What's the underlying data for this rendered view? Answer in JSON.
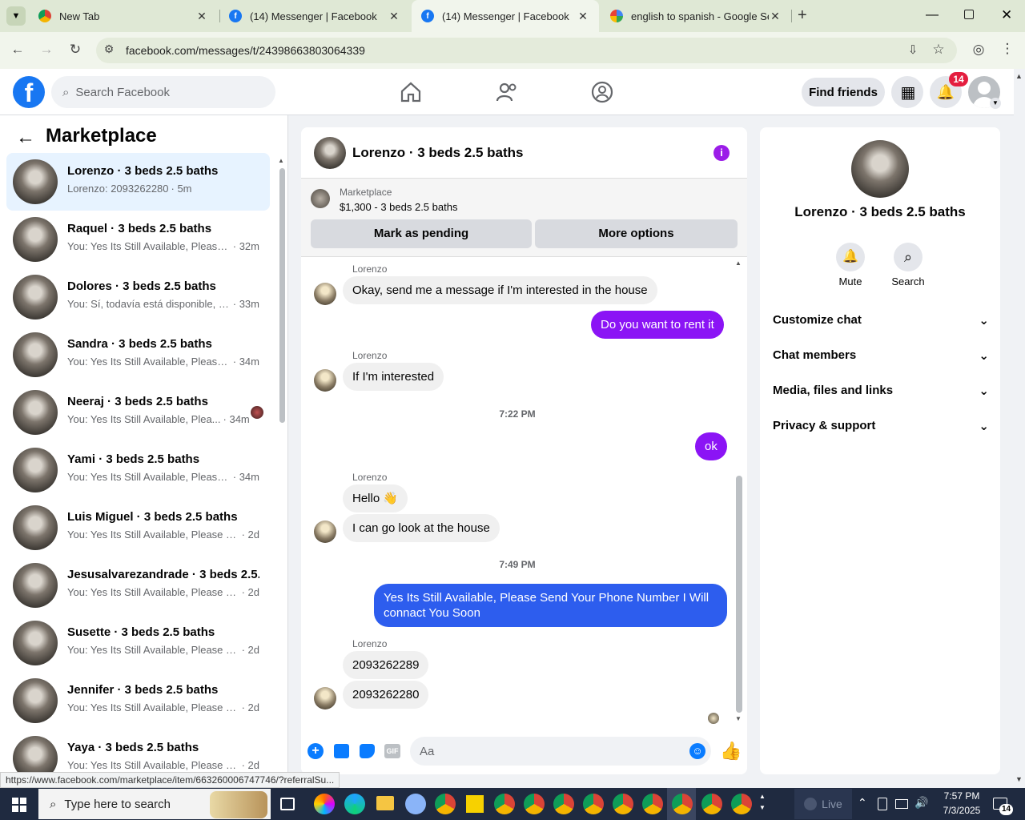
{
  "browser": {
    "tabs": [
      {
        "title": "New Tab",
        "icon": "chrome-icon"
      },
      {
        "title": "(14) Messenger | Facebook",
        "icon": "facebook-icon"
      },
      {
        "title": "(14) Messenger | Facebook",
        "icon": "facebook-icon"
      },
      {
        "title": "english to spanish - Google Sea",
        "icon": "google-icon"
      }
    ],
    "url": "facebook.com/messages/t/24398663803064339",
    "status_url": "https://www.facebook.com/marketplace/item/663260006747746/?referralSu..."
  },
  "fb_header": {
    "search_placeholder": "Search Facebook",
    "find_friends": "Find friends",
    "notification_count": "14"
  },
  "left": {
    "title": "Marketplace",
    "conversations": [
      {
        "name": "Lorenzo · 3 beds 2.5 baths",
        "preview": "Lorenzo: 2093262280",
        "time": " · 5m"
      },
      {
        "name": "Raquel · 3 beds 2.5 baths",
        "preview": "You: Yes Its Still Available, Please ...",
        "time": "· 32m"
      },
      {
        "name": "Dolores · 3 beds 2.5 baths",
        "preview": "You: Sí, todavía está disponible, e...",
        "time": "· 33m"
      },
      {
        "name": "Sandra · 3 beds 2.5 baths",
        "preview": "You: Yes Its Still Available, Please ...",
        "time": "· 34m"
      },
      {
        "name": "Neeraj · 3 beds 2.5 baths",
        "preview": "You: Yes Its Still Available, Plea...",
        "time": "· 34m"
      },
      {
        "name": "Yami · 3 beds 2.5 baths",
        "preview": "You: Yes Its Still Available, Please ...",
        "time": "· 34m"
      },
      {
        "name": "Luis Miguel · 3 beds 2.5 baths",
        "preview": "You: Yes Its Still Available, Please Se...",
        "time": "· 2d"
      },
      {
        "name": "Jesusalvarezandrade · 3 beds 2.5...",
        "preview": "You: Yes Its Still Available, Please Se...",
        "time": "· 2d"
      },
      {
        "name": "Susette · 3 beds 2.5 baths",
        "preview": "You: Yes Its Still Available, Please Se...",
        "time": "· 2d"
      },
      {
        "name": "Jennifer · 3 beds 2.5 baths",
        "preview": "You: Yes Its Still Available, Please Se...",
        "time": "· 2d"
      },
      {
        "name": "Yaya · 3 beds 2.5 baths",
        "preview": "You: Yes Its Still Available, Please Se...",
        "time": "· 2d"
      }
    ]
  },
  "chat": {
    "title": "Lorenzo · 3 beds 2.5 baths",
    "listing_source": "Marketplace",
    "listing_detail": "$1,300 - 3 beds 2.5 baths",
    "mark_pending": "Mark as pending",
    "more_options": "More options",
    "sender": "Lorenzo",
    "messages": [
      "Okay, send me a message if I'm interested in the house",
      "Do you want to rent it",
      "If I'm interested",
      "ok",
      "Hello 👋",
      "I can go look at the house",
      "Yes Its Still Available, Please Send Your Phone Number I Will connact You Soon",
      "2093262289",
      "2093262280"
    ],
    "timestamps": [
      "7:22 PM",
      "7:49 PM"
    ],
    "composer_placeholder": "Aa"
  },
  "right": {
    "name": "Lorenzo · 3 beds 2.5 baths",
    "mute": "Mute",
    "search": "Search",
    "options": [
      "Customize chat",
      "Chat members",
      "Media, files and links",
      "Privacy & support"
    ]
  },
  "taskbar": {
    "search_placeholder": "Type here to search",
    "time": "7:57 PM",
    "date": "7/3/2025",
    "live": "Live",
    "notif_count": "14"
  }
}
